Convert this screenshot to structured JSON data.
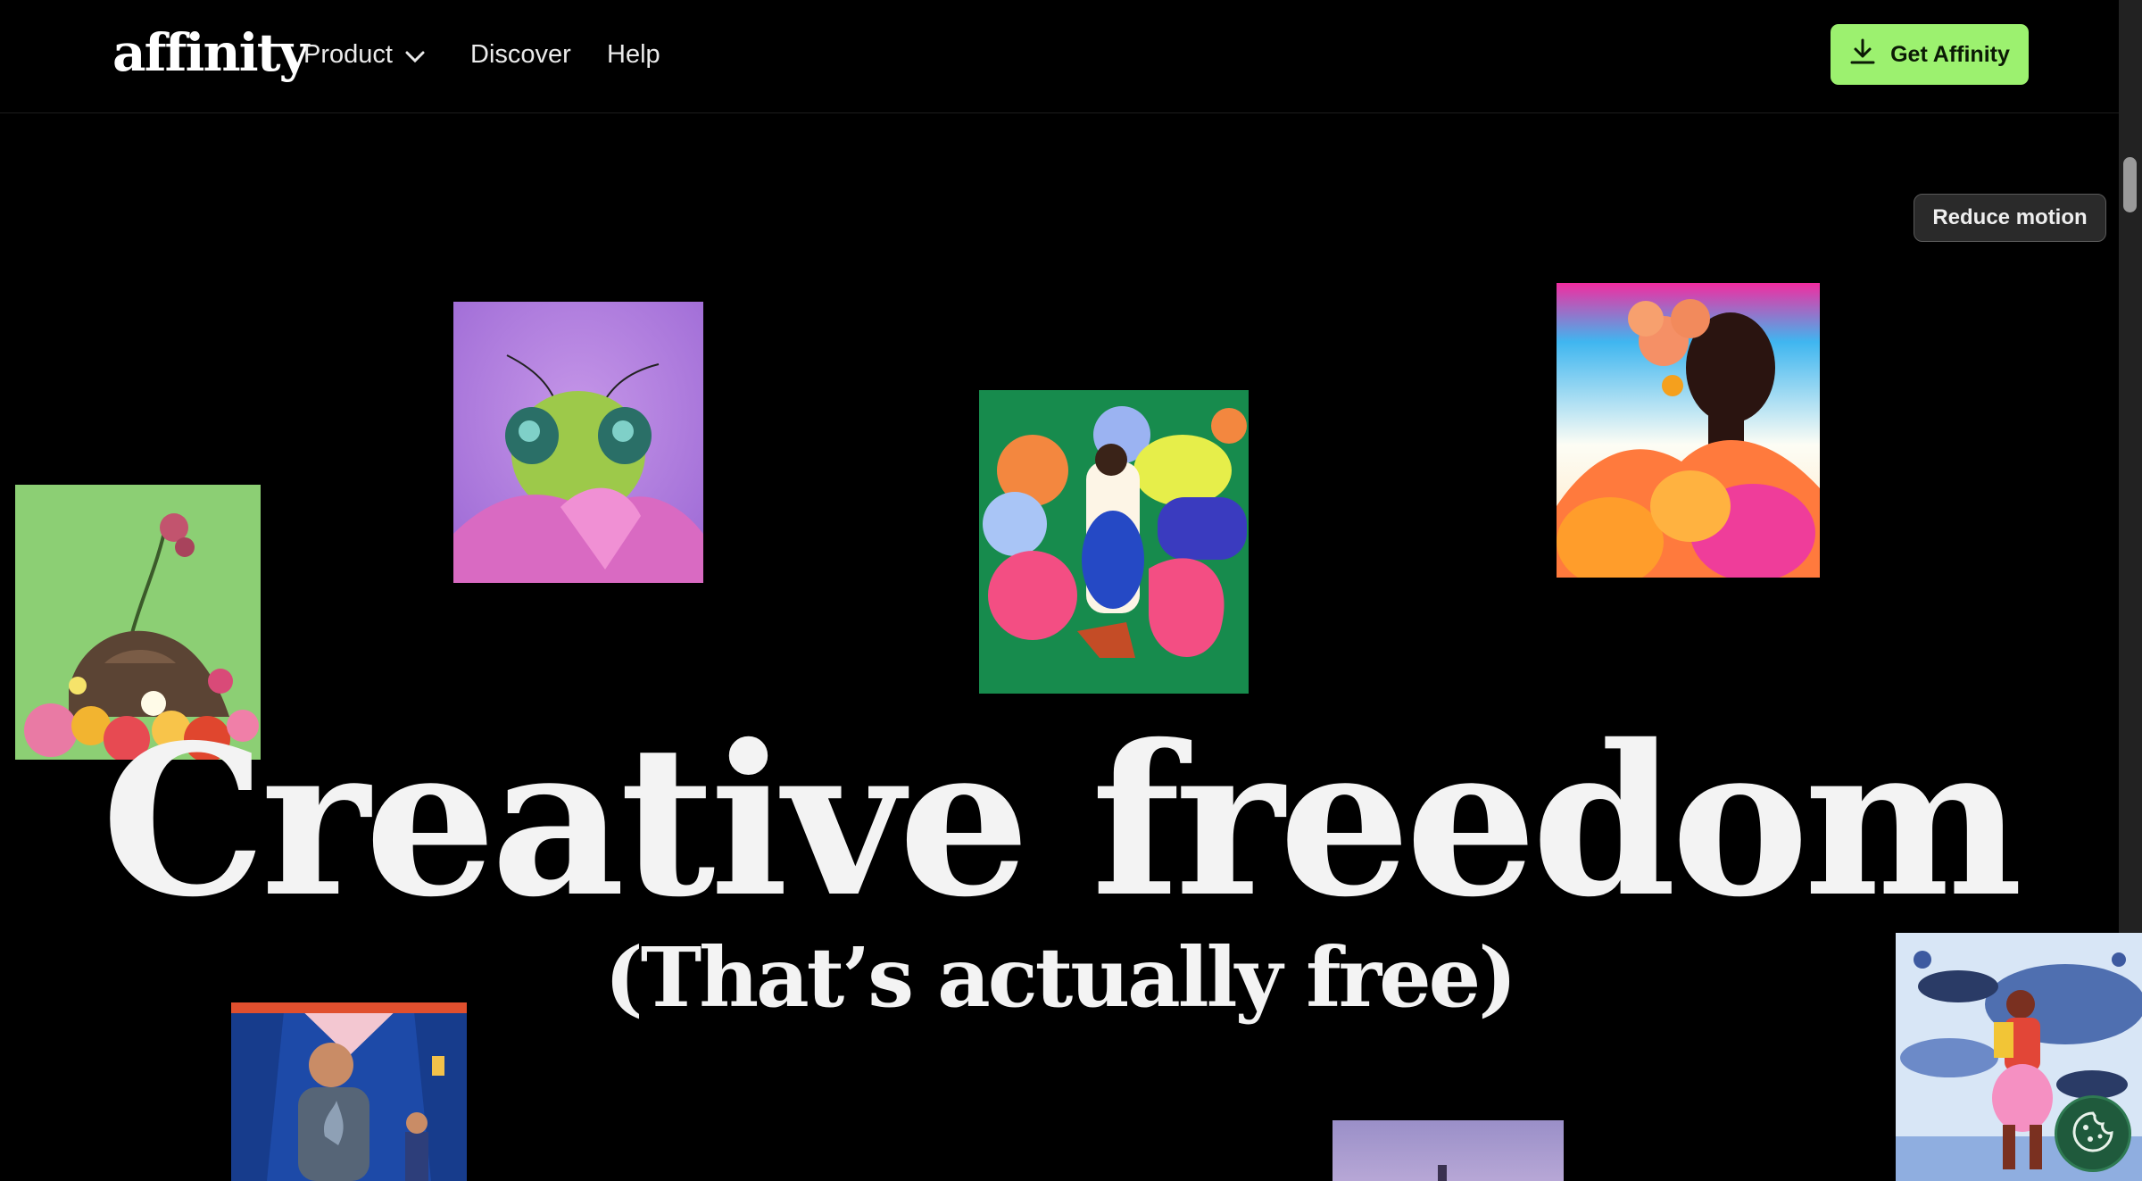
{
  "header": {
    "logo_text": "affinity",
    "nav": {
      "product": "Product",
      "discover": "Discover",
      "help": "Help"
    },
    "cta_label": "Get Affinity"
  },
  "reduce_motion_label": "Reduce motion",
  "hero": {
    "headline": "Creative freedom",
    "subheadline": "(That’s actually free)"
  },
  "artworks": [
    "flowers-on-rock-artwork",
    "green-insect-macro-artwork",
    "woman-walking-flowers-illustration",
    "woman-flower-portrait-artwork",
    "man-in-subway-illustration",
    "purple-sky-photo",
    "woman-with-whales-illustration"
  ],
  "colors": {
    "background": "#000000",
    "cta_green": "#9cf16f",
    "headline": "#f3f3f3"
  },
  "icons": [
    "chevron-down-icon",
    "download-icon",
    "cookie-icon"
  ]
}
